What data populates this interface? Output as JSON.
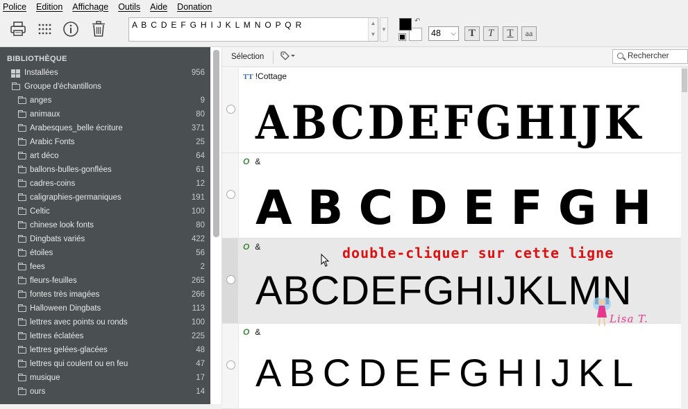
{
  "menu": [
    "Police",
    "Edition",
    "Affichage",
    "Outils",
    "Aide",
    "Donation"
  ],
  "toolbar": {
    "icons": [
      "printer-icon",
      "grid-dots-icon",
      "info-icon",
      "trash-icon"
    ],
    "preview_text": "A B C D E F G H I J K L M N O P Q R",
    "font_size": "48",
    "style_buttons": [
      "T",
      "T",
      "T",
      "aa"
    ],
    "foreground_color": "#000000",
    "background_color": "#ffffff"
  },
  "sidebar": {
    "title": "BIBLIOTHÈQUE",
    "installed": {
      "label": "Installées",
      "count": "956"
    },
    "group": {
      "label": "Groupe d'échantillons"
    },
    "folders": [
      {
        "label": "anges",
        "count": "9"
      },
      {
        "label": "animaux",
        "count": "80"
      },
      {
        "label": "Arabesques_belle écriture",
        "count": "371"
      },
      {
        "label": "Arabic Fonts",
        "count": "25"
      },
      {
        "label": "art déco",
        "count": "64"
      },
      {
        "label": "ballons-bulles-gonflées",
        "count": "61"
      },
      {
        "label": "cadres-coins",
        "count": "12"
      },
      {
        "label": "caligraphies-germaniques",
        "count": "191"
      },
      {
        "label": "Celtic",
        "count": "100"
      },
      {
        "label": "chinese look fonts",
        "count": "80"
      },
      {
        "label": "Dingbats variés",
        "count": "422"
      },
      {
        "label": "étoiles",
        "count": "56"
      },
      {
        "label": "fees",
        "count": "2"
      },
      {
        "label": "fleurs-feuilles",
        "count": "265"
      },
      {
        "label": "fontes très imagées",
        "count": "266"
      },
      {
        "label": "Halloween Dingbats",
        "count": "113"
      },
      {
        "label": "lettres avec points ou ronds",
        "count": "100"
      },
      {
        "label": "lettres éclatées",
        "count": "225"
      },
      {
        "label": "lettres gelées-glacées",
        "count": "48"
      },
      {
        "label": "lettres qui coulent ou en feu",
        "count": "47"
      },
      {
        "label": "musique",
        "count": "17"
      },
      {
        "label": "ours",
        "count": "14"
      }
    ]
  },
  "main": {
    "selection_label": "Sélection",
    "search_placeholder": "Rechercher",
    "fonts": [
      {
        "type": "TT",
        "name": "!Cottage",
        "sample": "ABCDEFGHIJK"
      },
      {
        "type": "O",
        "name": "&",
        "sample": "ABCDEFGH"
      },
      {
        "type": "O",
        "name": "&",
        "sample": "ABCDEFGHIJKLMN"
      },
      {
        "type": "O",
        "name": "&",
        "sample": "ABCDEFGHIJKL"
      }
    ],
    "annotation": "double-cliquer sur cette ligne",
    "watermark": "Lisa T."
  }
}
